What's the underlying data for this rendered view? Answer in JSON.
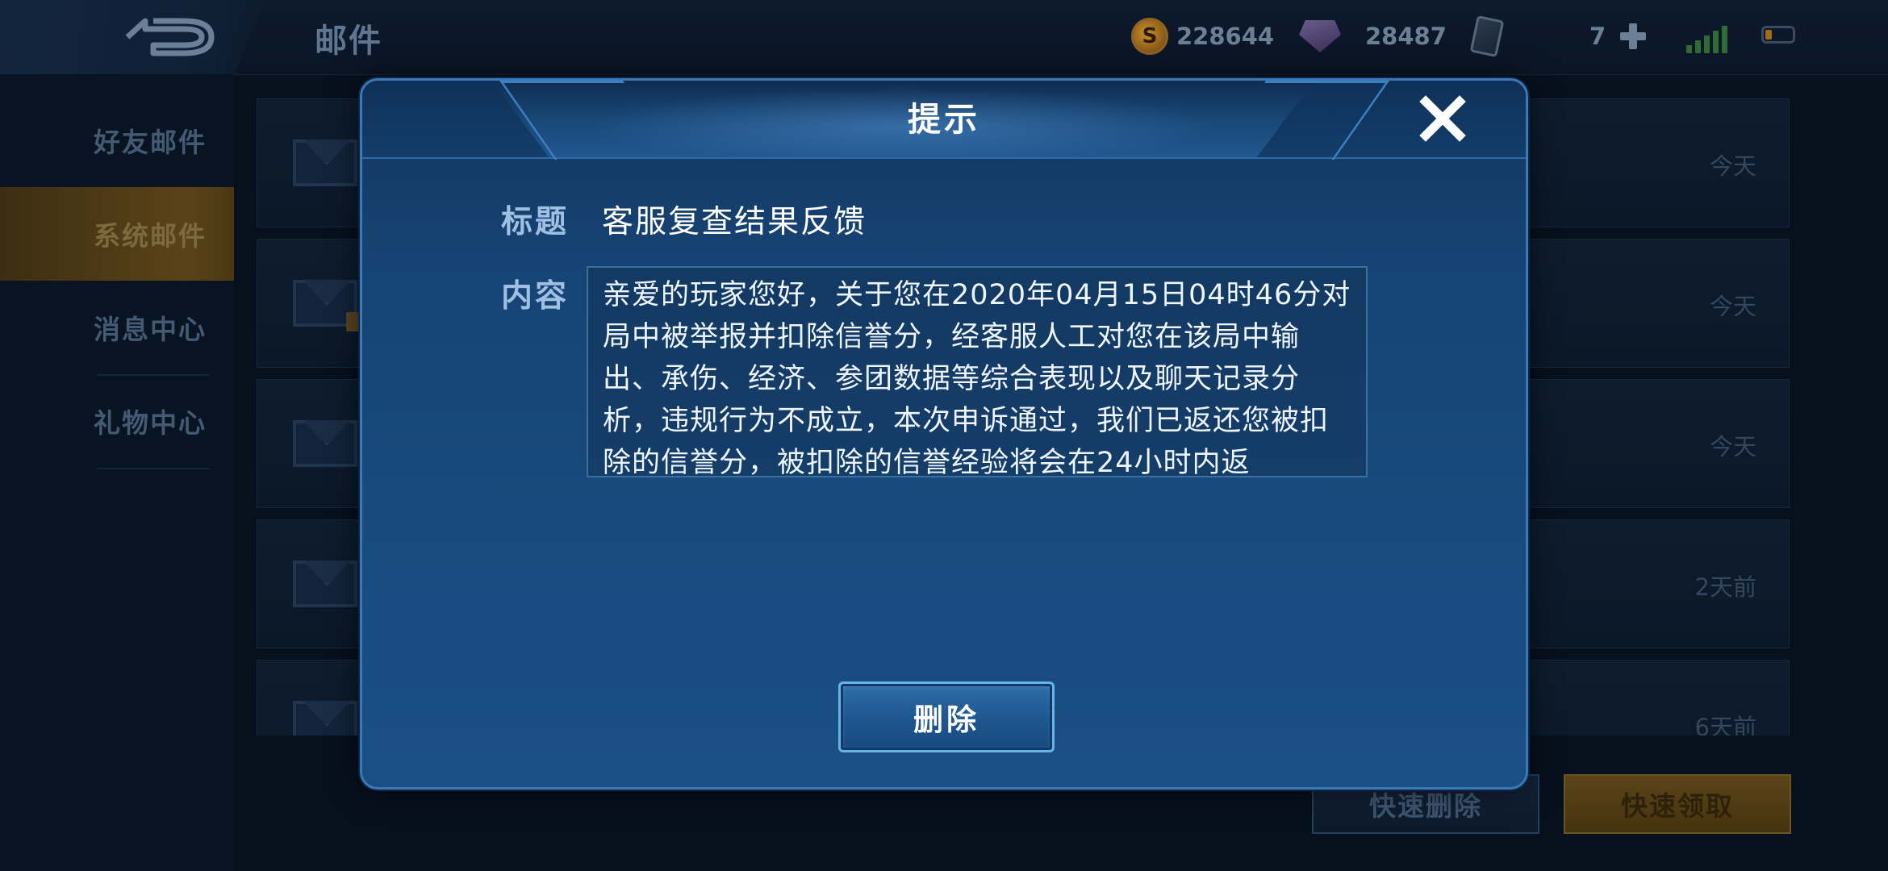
{
  "topbar": {
    "page_title": "邮件",
    "gold": "228644",
    "gems": "28487",
    "cards": "7",
    "signal_icon": "signal-icon",
    "battery_icon": "battery-icon"
  },
  "sidebar": {
    "items": [
      {
        "label": "好友邮件"
      },
      {
        "label": "系统邮件"
      },
      {
        "label": "消息中心"
      },
      {
        "label": "礼物中心"
      }
    ]
  },
  "mail_list": {
    "rows": [
      {
        "subject": "",
        "time": "今天"
      },
      {
        "subject": "",
        "time": "今天"
      },
      {
        "subject": "",
        "time": "今天"
      },
      {
        "subject": "",
        "time": "2天前"
      },
      {
        "subject": "",
        "time": "6天前"
      }
    ]
  },
  "bottom_buttons": {
    "quick_delete": "快速删除",
    "quick_claim": "快速领取"
  },
  "modal": {
    "title": "提示",
    "title_label": "标题",
    "title_value": "客服复查结果反馈",
    "content_label": "内容",
    "content_text": "亲爱的玩家您好，关于您在2020年04月15日04时46分对局中被举报并扣除信誉分，经客服人工对您在该局中输出、承伤、经济、参团数据等综合表现以及聊天记录分析，违规行为不成立，本次申诉通过，我们已返还您被扣除的信誉分，被扣除的信誉经验将会在24小时内返",
    "delete_label": "删除"
  },
  "colors": {
    "modal_border": "#3b78b5",
    "modal_bg": "#184a7d",
    "accent_gold": "#5a4318"
  }
}
